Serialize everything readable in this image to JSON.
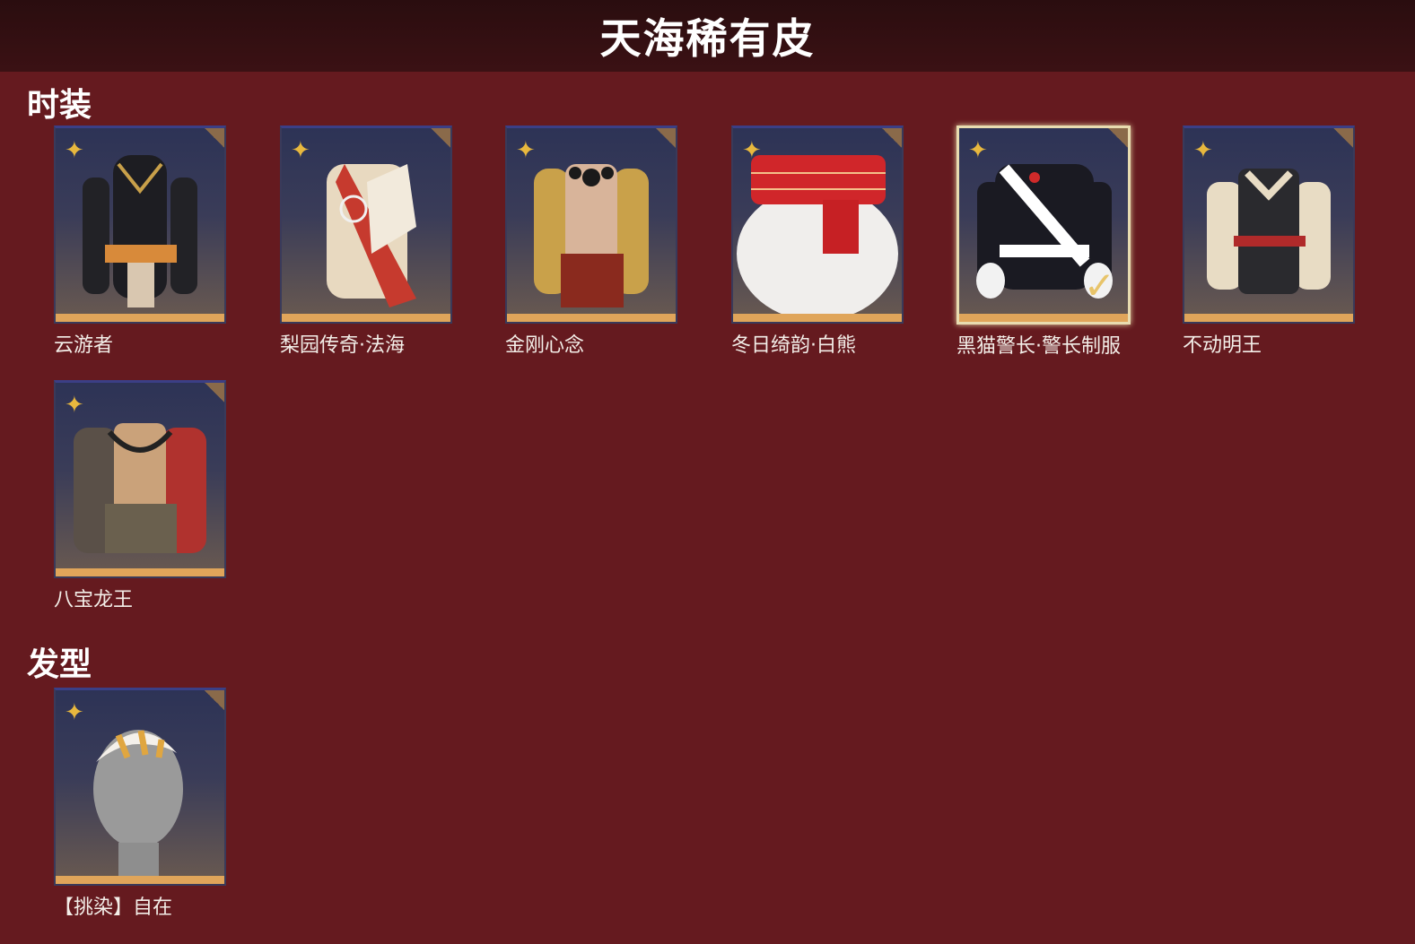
{
  "header": {
    "title": "天海稀有皮"
  },
  "sections": {
    "outfits": {
      "title": "时装",
      "items": [
        {
          "label": "云游者",
          "colors": {
            "primary": "#1a1a1e",
            "accent": "#c8a04a"
          }
        },
        {
          "label": "梨园传奇·法海",
          "colors": {
            "primary": "#efe2c8",
            "accent": "#c63a2e"
          }
        },
        {
          "label": "金刚心念",
          "colors": {
            "primary": "#c9a14a",
            "accent": "#8a2a1e"
          }
        },
        {
          "label": "冬日绮韵·白熊",
          "colors": {
            "primary": "#f0eeec",
            "accent": "#d0262a"
          }
        },
        {
          "label": "黑猫警长·警长制服",
          "colors": {
            "primary": "#1a1a22",
            "accent": "#ffffff"
          },
          "selected": true
        },
        {
          "label": "不动明王",
          "colors": {
            "primary": "#2a2a2e",
            "accent": "#b02a2a"
          }
        },
        {
          "label": "八宝龙王",
          "colors": {
            "primary": "#5a5048",
            "accent": "#b0322e"
          }
        }
      ]
    },
    "hair": {
      "title": "发型",
      "items": [
        {
          "label": "【挑染】自在",
          "colors": {
            "primary": "#9a9a9a",
            "accent": "#e0a640"
          }
        }
      ]
    }
  },
  "icons": {
    "rarity": "four-petal-star-icon",
    "selected": "checkmark-icon"
  }
}
